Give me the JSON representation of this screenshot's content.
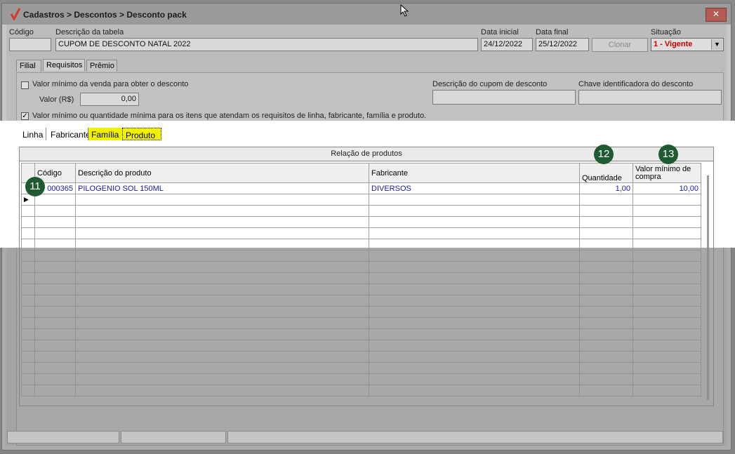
{
  "window": {
    "title": "Cadastros > Descontos > Desconto pack",
    "close_symbol": "✕",
    "logo_icon": "checkmark-logo-icon"
  },
  "header": {
    "codigo_label": "Código",
    "codigo_value": "",
    "descricao_label": "Descrição da tabela",
    "descricao_value": "CUPOM DE DESCONTO NATAL 2022",
    "data_inicial_label": "Data inicial",
    "data_inicial_value": "24/12/2022",
    "data_final_label": "Data final",
    "data_final_value": "25/12/2022",
    "clonar_label": "Clonar",
    "situacao_label": "Situação",
    "situacao_value": "1 - Vigente"
  },
  "outer_tabs": [
    "Filial",
    "Requisitos",
    "Prêmio"
  ],
  "requisitos": {
    "valor_minimo_venda_label": "Valor mínimo da venda para obter o desconto",
    "valor_label": "Valor (R$)",
    "valor_value": "0,00",
    "descricao_cupom_label": "Descrição do cupom de desconto",
    "chave_label": "Chave identificadora do desconto",
    "valor_qtd_minima_label": "Valor mínimo ou quantidade mínima para os itens que atendam os requisitos de linha, fabricante, família e produto."
  },
  "inner_tabs": [
    "Linha",
    "Fabricante",
    "Família",
    "Produto"
  ],
  "grid": {
    "caption": "Relação de produtos",
    "columns": [
      "Código",
      "Descrição do produto",
      "Fabricante",
      "Quantidade",
      "Valor mínimo de compra"
    ],
    "rows": [
      {
        "codigo": "000365",
        "descricao": "PILOGENIO SOL 150ML",
        "fabricante": "DIVERSOS",
        "quantidade": "1,00",
        "valor": "10,00"
      }
    ]
  },
  "badges": [
    "11",
    "12",
    "13"
  ],
  "colors": {
    "highlight": "#f2f200",
    "badge": "#1f5a33",
    "data_text": "#1a1aa8",
    "status_red": "#cc0000"
  }
}
